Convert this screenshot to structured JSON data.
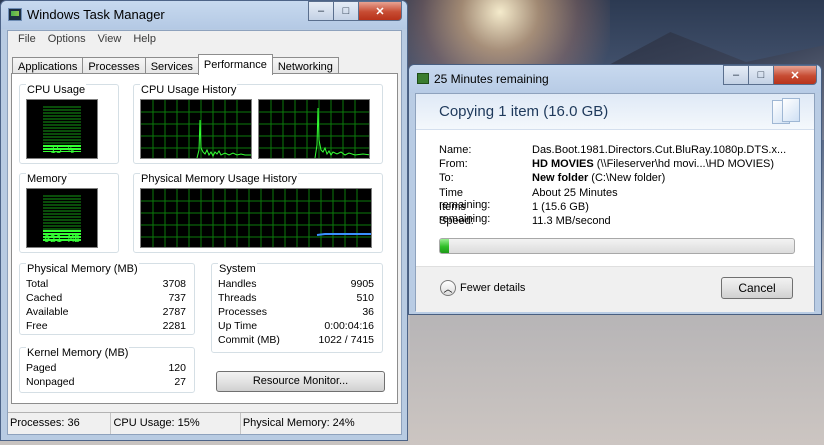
{
  "task_manager": {
    "title": "Windows Task Manager",
    "controls": [
      "–",
      "□",
      "✕"
    ],
    "menu": [
      "File",
      "Options",
      "View",
      "Help"
    ],
    "tabs": [
      "Applications",
      "Processes",
      "Services",
      "Performance",
      "Networking"
    ],
    "active_tab": "Performance",
    "cpu_usage": {
      "label": "CPU Usage",
      "value": "15 %",
      "level": 0.15
    },
    "cpu_history": {
      "label": "CPU Usage History"
    },
    "memory": {
      "label": "Memory",
      "value": "921 MB",
      "level": 0.24
    },
    "memory_history": {
      "label": "Physical Memory Usage History"
    },
    "physical_memory": {
      "title": "Physical Memory (MB)",
      "rows": [
        {
          "k": "Total",
          "v": "3708"
        },
        {
          "k": "Cached",
          "v": "737"
        },
        {
          "k": "Available",
          "v": "2787"
        },
        {
          "k": "Free",
          "v": "2281"
        }
      ]
    },
    "system": {
      "title": "System",
      "rows": [
        {
          "k": "Handles",
          "v": "9905"
        },
        {
          "k": "Threads",
          "v": "510"
        },
        {
          "k": "Processes",
          "v": "36"
        },
        {
          "k": "Up Time",
          "v": "0:00:04:16"
        },
        {
          "k": "Commit (MB)",
          "v": "1022 / 7415"
        }
      ]
    },
    "kernel_memory": {
      "title": "Kernel Memory (MB)",
      "rows": [
        {
          "k": "Paged",
          "v": "120"
        },
        {
          "k": "Nonpaged",
          "v": "27"
        }
      ]
    },
    "resource_monitor_button": "Resource Monitor...",
    "status": {
      "processes": "Processes: 36",
      "cpu": "CPU Usage: 15%",
      "memory": "Physical Memory: 24%"
    }
  },
  "copy_dialog": {
    "title": "25 Minutes remaining",
    "controls": [
      "–",
      "□",
      "✕"
    ],
    "heading": "Copying 1 item (16.0 GB)",
    "rows": [
      {
        "label": "Name:",
        "value": "Das.Boot.1981.Directors.Cut.BluRay.1080p.DTS.x...",
        "bold_part": "",
        "rest": ""
      },
      {
        "label": "From:",
        "bold_part": "HD MOVIES",
        "rest": " (\\\\Fileserver\\hd movi...\\HD MOVIES)"
      },
      {
        "label": "To:",
        "bold_part": "New folder",
        "rest": " (C:\\New folder)"
      },
      {
        "label": "Time remaining:",
        "value": "About 25 Minutes"
      },
      {
        "label": "Items remaining:",
        "value": "1 (15.6 GB)"
      },
      {
        "label": "Speed:",
        "value": "11.3 MB/second"
      }
    ],
    "progress": 0.025,
    "fewer_details": "Fewer details",
    "cancel": "Cancel"
  },
  "colors": {
    "graph_green": "#34ff34",
    "grid_green": "#0b7a0b",
    "memory_line": "#3a8fff",
    "progress_green": "#2fbf27"
  }
}
